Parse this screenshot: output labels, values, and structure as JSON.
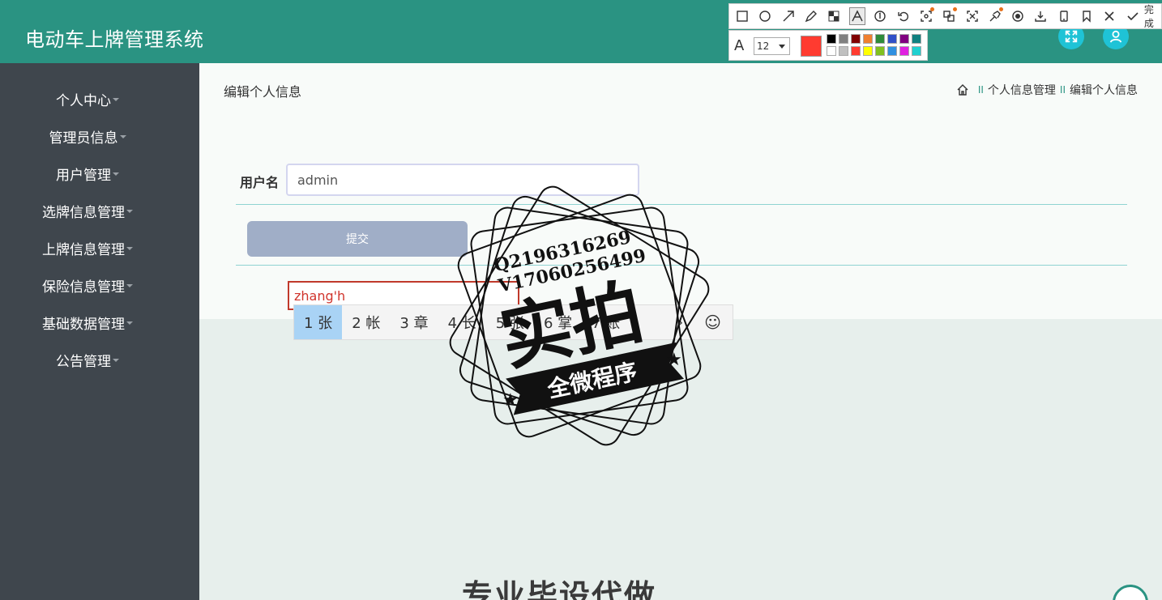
{
  "header": {
    "title": "电动车上牌管理系统"
  },
  "header_buttons": {
    "fullscreen": "expand-icon",
    "user": "user-icon"
  },
  "sidebar": {
    "items": [
      {
        "label": "个人中心"
      },
      {
        "label": "管理员信息"
      },
      {
        "label": "用户管理"
      },
      {
        "label": "选牌信息管理"
      },
      {
        "label": "上牌信息管理"
      },
      {
        "label": "保险信息管理"
      },
      {
        "label": "基础数据管理"
      },
      {
        "label": "公告管理"
      }
    ]
  },
  "page": {
    "title": "编辑个人信息",
    "breadcrumb": {
      "sep": "II",
      "items": [
        "个人信息管理",
        "编辑个人信息"
      ]
    }
  },
  "form": {
    "username_label": "用户名",
    "username_value": "admin",
    "submit_label": "提交"
  },
  "ime": {
    "composition": "zhang'h",
    "candidates": [
      "1 张",
      "2 帐",
      "3 章",
      "4 长",
      "5 张",
      "6 掌",
      "7 账"
    ],
    "next": "›",
    "emoji": "☺"
  },
  "watermark": {
    "line1": "Q2196316269",
    "line2": "V17060256499",
    "main": "实拍",
    "ribbon": "全微程序"
  },
  "bottom_text": "专业毕设代做",
  "screenshot_tool": {
    "done_label": "完成",
    "font_size": "12",
    "current_color": "#ff3b30",
    "palette": [
      "#000000",
      "#808080",
      "#800000",
      "#f08030",
      "#2e8b3a",
      "#3050c8",
      "#800080",
      "#108080",
      "#ffffff",
      "#c0c0c0",
      "#ff3b30",
      "#ffff00",
      "#80c020",
      "#3090e0",
      "#e020e0",
      "#20d0d0"
    ],
    "tools": [
      "rect-icon",
      "ellipse-icon",
      "arrow-icon",
      "pencil-icon",
      "mosaic-icon",
      "text-icon",
      "number-icon",
      "undo-icon",
      "ocr-icon",
      "translate-icon",
      "long-screenshot-icon",
      "pin-icon",
      "record-icon",
      "download-icon",
      "phone-icon",
      "bookmark-icon",
      "close-icon",
      "check-icon"
    ]
  },
  "colors": {
    "header": "#2a9382",
    "sidebar": "#3f464d",
    "accent": "#1fc3d6",
    "submit": "#a0aec7"
  }
}
